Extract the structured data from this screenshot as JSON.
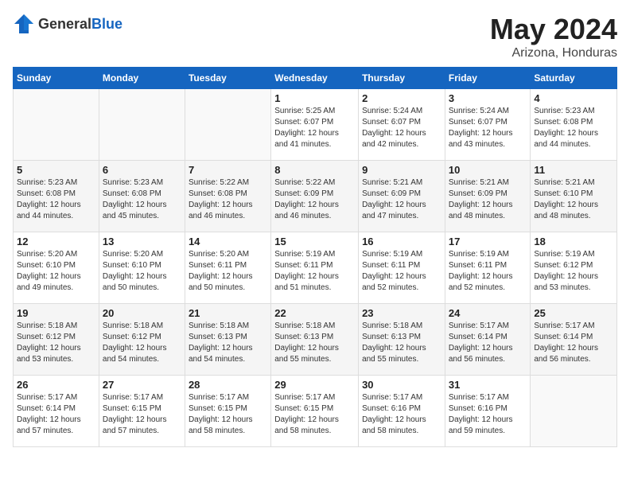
{
  "header": {
    "logo_general": "General",
    "logo_blue": "Blue",
    "month_year": "May 2024",
    "location": "Arizona, Honduras"
  },
  "days_of_week": [
    "Sunday",
    "Monday",
    "Tuesday",
    "Wednesday",
    "Thursday",
    "Friday",
    "Saturday"
  ],
  "weeks": [
    [
      {
        "day": "",
        "info": ""
      },
      {
        "day": "",
        "info": ""
      },
      {
        "day": "",
        "info": ""
      },
      {
        "day": "1",
        "info": "Sunrise: 5:25 AM\nSunset: 6:07 PM\nDaylight: 12 hours\nand 41 minutes."
      },
      {
        "day": "2",
        "info": "Sunrise: 5:24 AM\nSunset: 6:07 PM\nDaylight: 12 hours\nand 42 minutes."
      },
      {
        "day": "3",
        "info": "Sunrise: 5:24 AM\nSunset: 6:07 PM\nDaylight: 12 hours\nand 43 minutes."
      },
      {
        "day": "4",
        "info": "Sunrise: 5:23 AM\nSunset: 6:08 PM\nDaylight: 12 hours\nand 44 minutes."
      }
    ],
    [
      {
        "day": "5",
        "info": "Sunrise: 5:23 AM\nSunset: 6:08 PM\nDaylight: 12 hours\nand 44 minutes."
      },
      {
        "day": "6",
        "info": "Sunrise: 5:23 AM\nSunset: 6:08 PM\nDaylight: 12 hours\nand 45 minutes."
      },
      {
        "day": "7",
        "info": "Sunrise: 5:22 AM\nSunset: 6:08 PM\nDaylight: 12 hours\nand 46 minutes."
      },
      {
        "day": "8",
        "info": "Sunrise: 5:22 AM\nSunset: 6:09 PM\nDaylight: 12 hours\nand 46 minutes."
      },
      {
        "day": "9",
        "info": "Sunrise: 5:21 AM\nSunset: 6:09 PM\nDaylight: 12 hours\nand 47 minutes."
      },
      {
        "day": "10",
        "info": "Sunrise: 5:21 AM\nSunset: 6:09 PM\nDaylight: 12 hours\nand 48 minutes."
      },
      {
        "day": "11",
        "info": "Sunrise: 5:21 AM\nSunset: 6:10 PM\nDaylight: 12 hours\nand 48 minutes."
      }
    ],
    [
      {
        "day": "12",
        "info": "Sunrise: 5:20 AM\nSunset: 6:10 PM\nDaylight: 12 hours\nand 49 minutes."
      },
      {
        "day": "13",
        "info": "Sunrise: 5:20 AM\nSunset: 6:10 PM\nDaylight: 12 hours\nand 50 minutes."
      },
      {
        "day": "14",
        "info": "Sunrise: 5:20 AM\nSunset: 6:11 PM\nDaylight: 12 hours\nand 50 minutes."
      },
      {
        "day": "15",
        "info": "Sunrise: 5:19 AM\nSunset: 6:11 PM\nDaylight: 12 hours\nand 51 minutes."
      },
      {
        "day": "16",
        "info": "Sunrise: 5:19 AM\nSunset: 6:11 PM\nDaylight: 12 hours\nand 52 minutes."
      },
      {
        "day": "17",
        "info": "Sunrise: 5:19 AM\nSunset: 6:11 PM\nDaylight: 12 hours\nand 52 minutes."
      },
      {
        "day": "18",
        "info": "Sunrise: 5:19 AM\nSunset: 6:12 PM\nDaylight: 12 hours\nand 53 minutes."
      }
    ],
    [
      {
        "day": "19",
        "info": "Sunrise: 5:18 AM\nSunset: 6:12 PM\nDaylight: 12 hours\nand 53 minutes."
      },
      {
        "day": "20",
        "info": "Sunrise: 5:18 AM\nSunset: 6:12 PM\nDaylight: 12 hours\nand 54 minutes."
      },
      {
        "day": "21",
        "info": "Sunrise: 5:18 AM\nSunset: 6:13 PM\nDaylight: 12 hours\nand 54 minutes."
      },
      {
        "day": "22",
        "info": "Sunrise: 5:18 AM\nSunset: 6:13 PM\nDaylight: 12 hours\nand 55 minutes."
      },
      {
        "day": "23",
        "info": "Sunrise: 5:18 AM\nSunset: 6:13 PM\nDaylight: 12 hours\nand 55 minutes."
      },
      {
        "day": "24",
        "info": "Sunrise: 5:17 AM\nSunset: 6:14 PM\nDaylight: 12 hours\nand 56 minutes."
      },
      {
        "day": "25",
        "info": "Sunrise: 5:17 AM\nSunset: 6:14 PM\nDaylight: 12 hours\nand 56 minutes."
      }
    ],
    [
      {
        "day": "26",
        "info": "Sunrise: 5:17 AM\nSunset: 6:14 PM\nDaylight: 12 hours\nand 57 minutes."
      },
      {
        "day": "27",
        "info": "Sunrise: 5:17 AM\nSunset: 6:15 PM\nDaylight: 12 hours\nand 57 minutes."
      },
      {
        "day": "28",
        "info": "Sunrise: 5:17 AM\nSunset: 6:15 PM\nDaylight: 12 hours\nand 58 minutes."
      },
      {
        "day": "29",
        "info": "Sunrise: 5:17 AM\nSunset: 6:15 PM\nDaylight: 12 hours\nand 58 minutes."
      },
      {
        "day": "30",
        "info": "Sunrise: 5:17 AM\nSunset: 6:16 PM\nDaylight: 12 hours\nand 58 minutes."
      },
      {
        "day": "31",
        "info": "Sunrise: 5:17 AM\nSunset: 6:16 PM\nDaylight: 12 hours\nand 59 minutes."
      },
      {
        "day": "",
        "info": ""
      }
    ]
  ]
}
